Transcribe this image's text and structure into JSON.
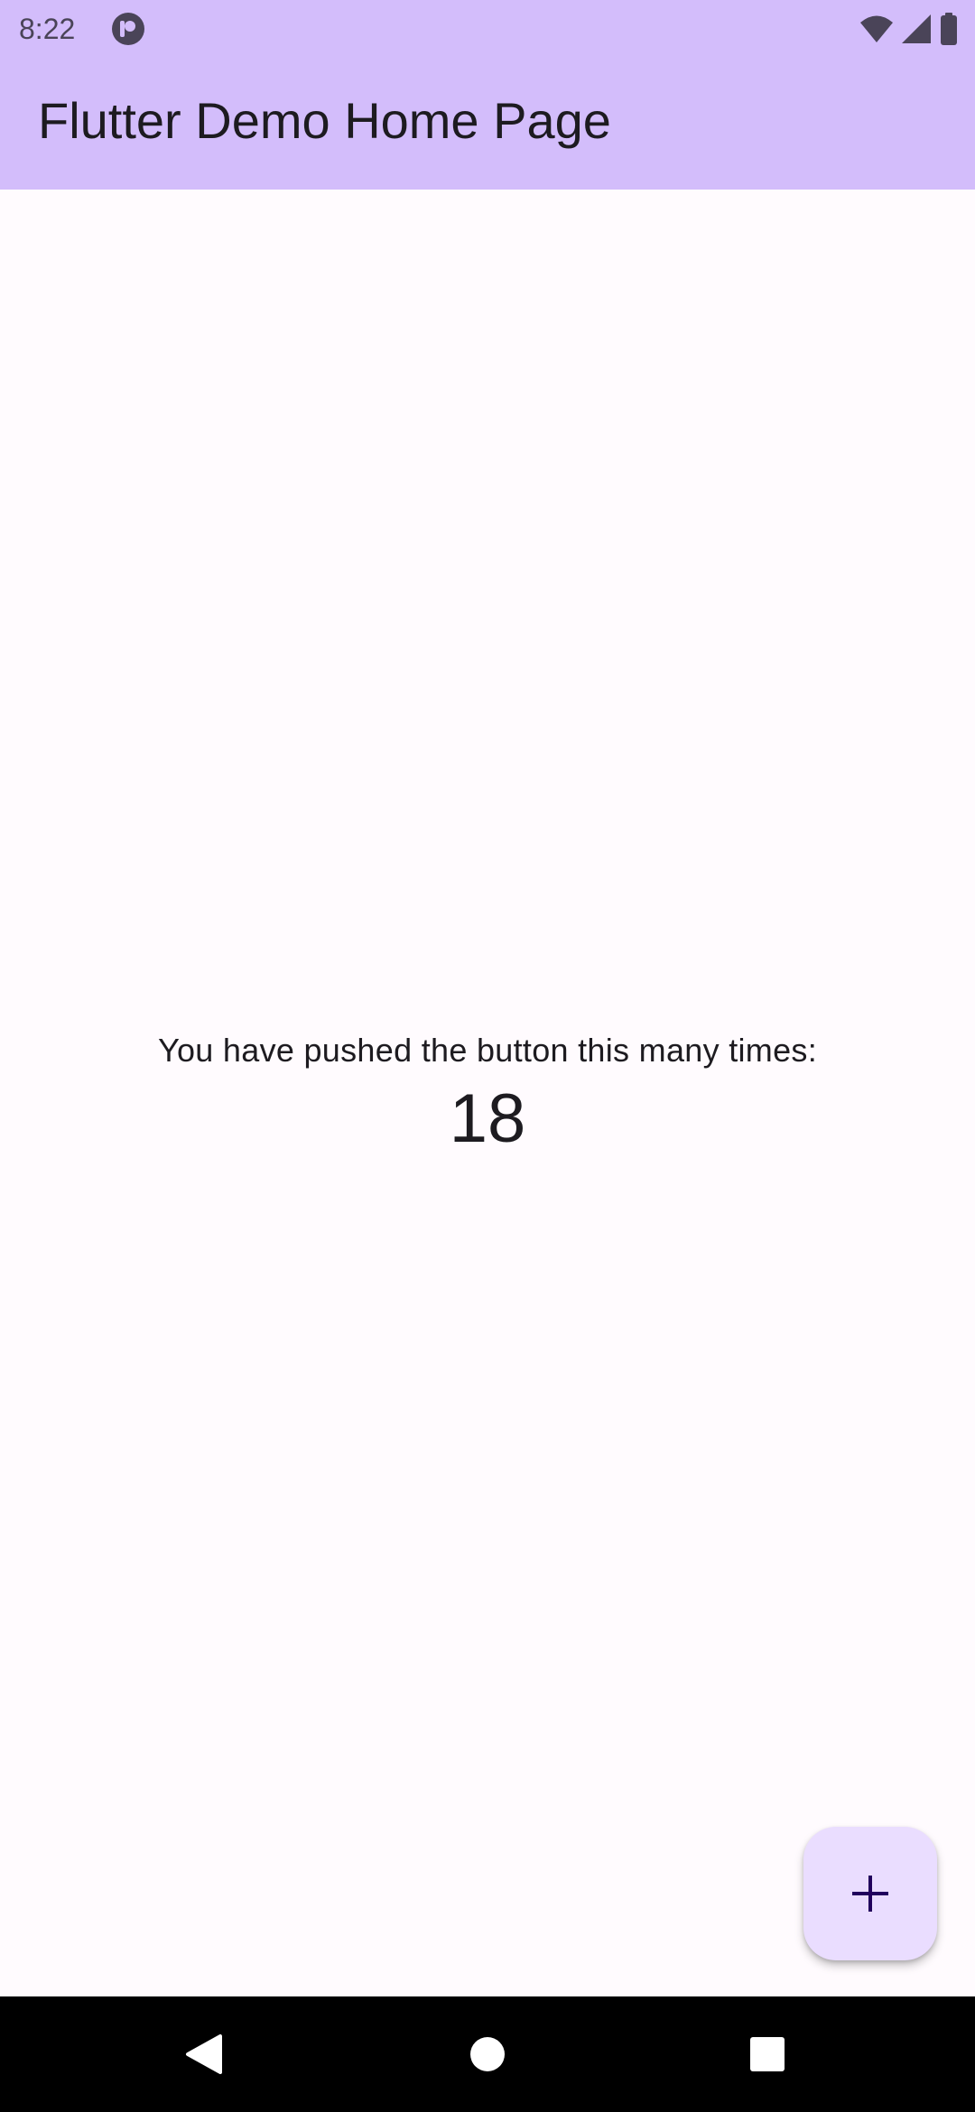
{
  "status_bar": {
    "time": "8:22",
    "icons": [
      "app-notification-icon",
      "wifi-icon",
      "cellular-signal-icon",
      "battery-icon"
    ]
  },
  "app_bar": {
    "title": "Flutter Demo Home Page",
    "background_color": "#d3bdfb"
  },
  "body": {
    "counter_label": "You have pushed the button this many times:",
    "counter_value": "18",
    "background_color": "#fffbfe"
  },
  "fab": {
    "icon": "add-icon",
    "background_color": "#eaddff",
    "icon_color": "#21005d"
  },
  "navigation_bar": {
    "buttons": [
      "back-icon",
      "home-icon",
      "recents-icon"
    ],
    "background_color": "#000000"
  }
}
